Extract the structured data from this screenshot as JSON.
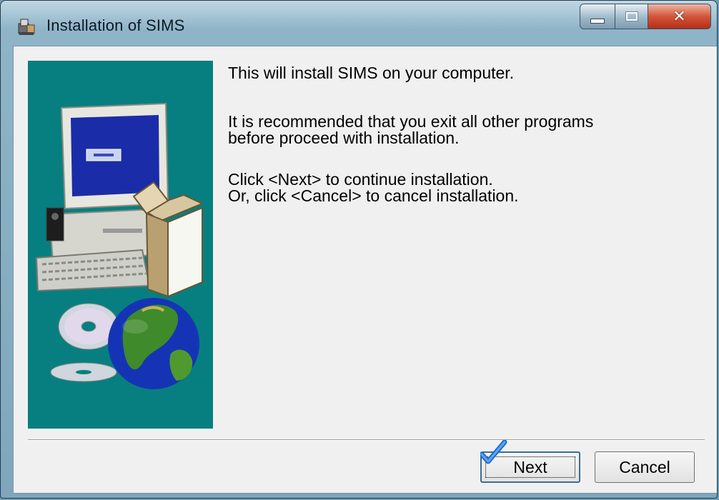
{
  "window": {
    "title": "Installation of SIMS",
    "icons": [
      "installer-icon",
      "minimize-icon",
      "maximize-icon",
      "close-icon"
    ]
  },
  "content": {
    "paragraph1": "This will install SIMS on your computer.",
    "paragraph2": "It is recommended that you exit all other programs\nbefore proceed with installation.",
    "paragraph3": "Click <Next> to continue installation.\nOr, click <Cancel> to cancel installation."
  },
  "side_panel": {
    "background": "#077f80",
    "art": [
      "computer-icon",
      "box-icon",
      "cd-icon",
      "globe-icon"
    ]
  },
  "buttons": {
    "next_label": "Next",
    "cancel_label": "Cancel"
  }
}
